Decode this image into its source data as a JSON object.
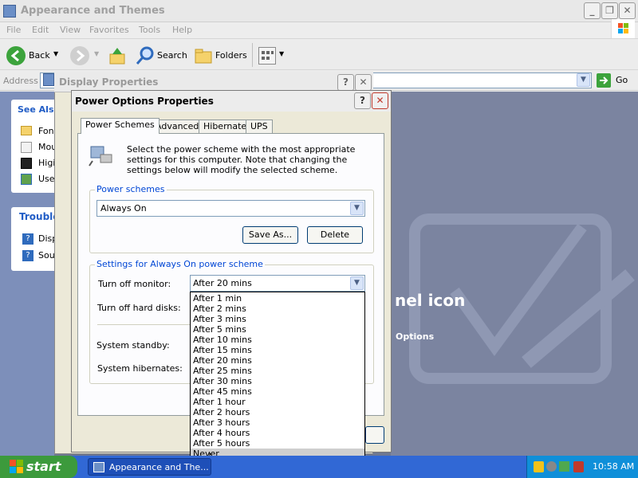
{
  "explorer": {
    "title": "Appearance and Themes",
    "menu": [
      "File",
      "Edit",
      "View",
      "Favorites",
      "Tools",
      "Help"
    ],
    "toolbar": {
      "back_label": "Back",
      "search_label": "Search",
      "folders_label": "Folders"
    },
    "address_label": "Address",
    "go_label": "Go"
  },
  "left_panel": {
    "see_also_title": "See Als",
    "see_also_items": [
      "Fon",
      "Mou",
      "Higi",
      "Use"
    ],
    "troubleshooters_title": "Trouble",
    "troubleshooter_items": [
      "Disp",
      "Sou"
    ]
  },
  "background_text": {
    "control_panel_icon": "nel icon",
    "options": "Options"
  },
  "display_properties": {
    "title": "Display Properties",
    "help_glyph": "?",
    "close_glyph": "✕"
  },
  "power_options": {
    "title": "Power Options Properties",
    "help_glyph": "?",
    "close_glyph": "✕",
    "tabs": [
      "Power Schemes",
      "Advanced",
      "Hibernate",
      "UPS"
    ],
    "description": "Select the power scheme with the most appropriate settings for this computer. Note that changing the settings below will modify the selected scheme.",
    "power_schemes_label": "Power schemes",
    "scheme_value": "Always On",
    "save_as_label": "Save As...",
    "delete_label": "Delete",
    "settings_label": "Settings for Always On power scheme",
    "turn_off_monitor_label": "Turn off monitor:",
    "turn_off_monitor_value": "After 20 mins",
    "turn_off_disks_label": "Turn off hard disks:",
    "standby_label": "System standby:",
    "hibernates_label": "System hibernates:",
    "dropdown_options": [
      "After 1 min",
      "After 2 mins",
      "After 3 mins",
      "After 5 mins",
      "After 10 mins",
      "After 15 mins",
      "After 20 mins",
      "After 25 mins",
      "After 30 mins",
      "After 45 mins",
      "After 1 hour",
      "After 2 hours",
      "After 3 hours",
      "After 4 hours",
      "After 5 hours",
      "Never"
    ],
    "dropdown_highlighted": "Never"
  },
  "taskbar": {
    "start_label": "start",
    "task_label": "Appearance and The...",
    "clock": "10:58 AM"
  },
  "colors": {
    "taskbar": "#3168d5",
    "start": "#3c9a3c",
    "tray": "#0f8fd9",
    "group_label": "#0046d5"
  }
}
